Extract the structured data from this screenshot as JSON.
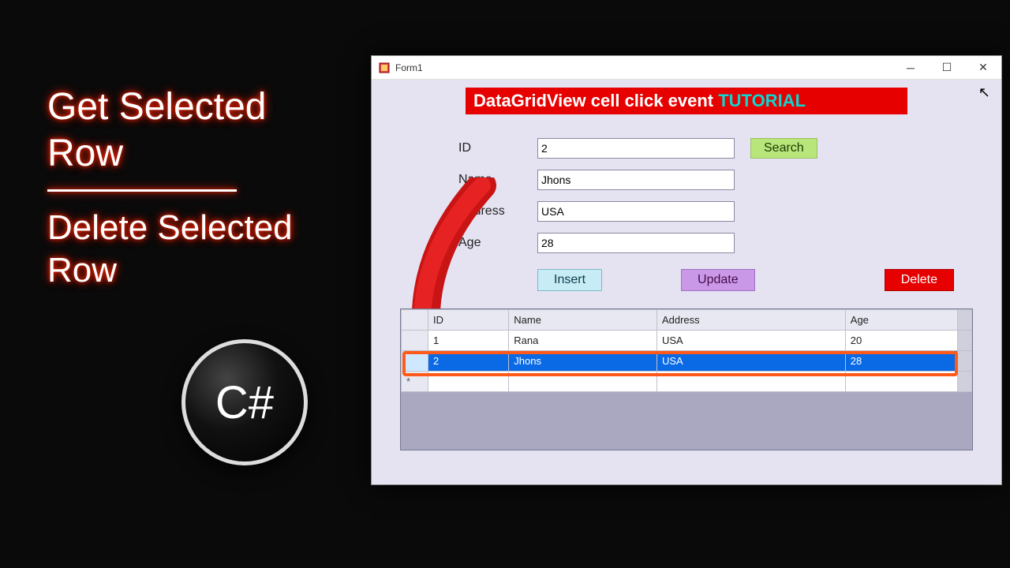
{
  "side": {
    "line1": "Get Selected",
    "line2": "Row",
    "line3": "Delete Selected",
    "line4": "Row"
  },
  "badge": {
    "label": "C#"
  },
  "window": {
    "title": "Form1",
    "banner_prefix": "DataGridView cell click event ",
    "banner_suffix": "TUTORIAL",
    "form": {
      "id_label": "ID",
      "id_value": "2",
      "name_label": "Name",
      "name_value": "Jhons",
      "address_label": "Address",
      "address_value": "USA",
      "age_label": "Age",
      "age_value": "28"
    },
    "buttons": {
      "search": "Search",
      "insert": "Insert",
      "update": "Update",
      "delete": "Delete"
    },
    "grid": {
      "headers": [
        "ID",
        "Name",
        "Address",
        "Age"
      ],
      "rows": [
        {
          "cells": [
            "1",
            "Rana",
            "USA",
            "20"
          ],
          "selected": false
        },
        {
          "cells": [
            "2",
            "Jhons",
            "USA",
            "28"
          ],
          "selected": true
        }
      ]
    }
  }
}
